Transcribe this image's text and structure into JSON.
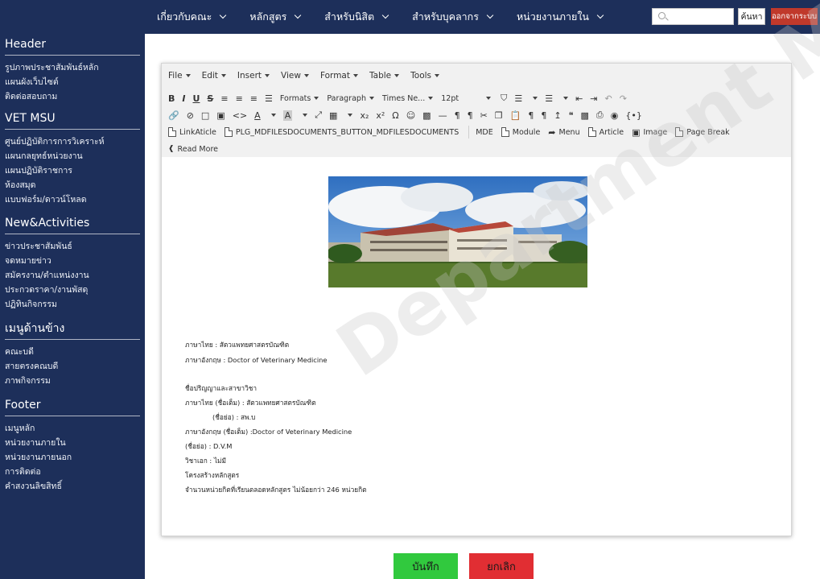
{
  "topnav": {
    "items": [
      {
        "label": "เกี่ยวกับคณะ"
      },
      {
        "label": "หลักสูตร"
      },
      {
        "label": "สำหรับนิสิต"
      },
      {
        "label": "สำหรับบุคลากร"
      },
      {
        "label": "หน่วยงานภายใน"
      }
    ],
    "search_placeholder": "",
    "search_button": "ค้นหา",
    "logout_button": "ออกจากระบบ"
  },
  "sidebar": {
    "sections": [
      {
        "heading": "Header",
        "items": [
          "รูปภาพประชาสัมพันธ์หลัก",
          "แผนผังเว็บไซต์",
          "ติดต่อสอบถาม"
        ]
      },
      {
        "heading": "VET MSU",
        "items": [
          "ศูนย์ปฏิบัติการการวิเคราะห์",
          "แผนกลยุทธ์หน่วยงาน",
          "แผนปฏิบัติราชการ",
          "ห้องสมุด",
          "แบบฟอร์ม/ดาวน์โหลด"
        ]
      },
      {
        "heading": "New&Activities",
        "items": [
          "ข่าวประชาสัมพันธ์",
          "จดหมายข่าว",
          "สมัครงาน/ตำแหน่งงาน",
          "ประกวดราคา/งานพัสดุ",
          "ปฏิทินกิจกรรม"
        ]
      },
      {
        "heading": "เมนูด้านข้าง",
        "items": [
          "คณะบดี",
          "สายตรงคณบดี",
          "ภาพกิจกรรม"
        ]
      },
      {
        "heading": "Footer",
        "items": [
          "เมนูหลัก",
          "หน่วยงานภายใน",
          "หน่วยงานภายนอก",
          "การติดต่อ",
          "คำสงวนลิขสิทธิ์"
        ]
      }
    ]
  },
  "editor": {
    "menubar": [
      "File",
      "Edit",
      "Insert",
      "View",
      "Format",
      "Table",
      "Tools"
    ],
    "toolbar": {
      "formats": "Formats",
      "paragraph": "Paragraph",
      "font": "Times Ne...",
      "size": "12pt",
      "insert_buttons": [
        "LinkAticle",
        "PLG_MDFILESDOCUMENTS_BUTTON_MDFILESDOCUMENTS",
        "MDE",
        "Module",
        "Menu",
        "Article",
        "Image",
        "Page Break"
      ],
      "read_more": "Read More"
    },
    "content": {
      "lines": [
        "ภาษาไทย : สัตวแพทยศาสตรบัณฑิต",
        "ภาษาอังกฤษ : Doctor of Veterinary Medicine",
        "ชื่อปริญญาและสาขาวิชา",
        "ภาษาไทย (ชื่อเต็ม) : สัตวแพทยศาสตรบัณฑิต",
        "(ชื่อย่อ) : สพ.บ",
        "ภาษาอังกฤษ (ชื่อเต็ม) :Doctor of Veterinary Medicine",
        "(ชื่อย่อ) : D.V.M",
        "วิชาเอก : ไม่มี",
        "โครงสร้างหลักสูตร",
        "จำนวนหน่วยกิตที่เรียนตลอดหลักสูตร ไม่น้อยกว่า 246 หน่วยกิต"
      ]
    }
  },
  "actions": {
    "save": "บันทึก",
    "cancel": "ยกเลิก"
  },
  "watermark": "Department Mahasarakham University",
  "colors": {
    "nav_bg": "#1d2f5a",
    "save": "#31c93e",
    "cancel": "#e12e33",
    "logout": "#c0392b"
  }
}
